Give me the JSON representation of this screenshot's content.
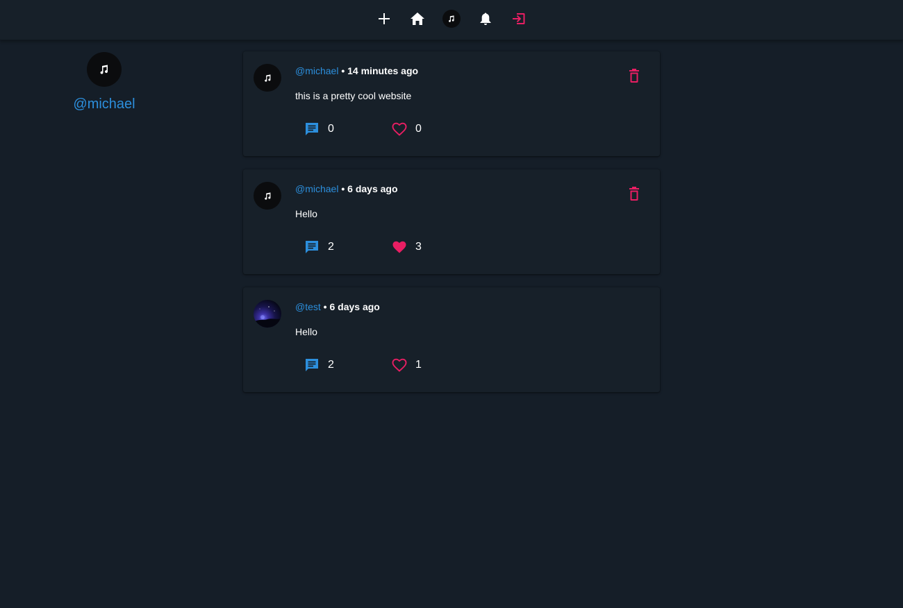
{
  "topbar": {
    "icons": [
      "plus-icon",
      "home-icon",
      "avatar",
      "bell-icon",
      "logout-icon"
    ],
    "accent_logout": "#e91e63"
  },
  "profile": {
    "handle": "@michael",
    "avatar": "music-note-icon"
  },
  "posts": [
    {
      "user": "@michael",
      "separator": "•",
      "time": "14 minutes ago",
      "body": "this is a pretty cool website",
      "comments": "0",
      "likes": "0",
      "liked": false,
      "deletable": true,
      "avatar": "music-note-icon"
    },
    {
      "user": "@michael",
      "separator": "•",
      "time": "6 days ago",
      "body": "Hello",
      "comments": "2",
      "likes": "3",
      "liked": true,
      "deletable": true,
      "avatar": "music-note-icon"
    },
    {
      "user": "@test",
      "separator": "•",
      "time": "6 days ago",
      "body": "Hello",
      "comments": "2",
      "likes": "1",
      "liked": false,
      "deletable": false,
      "avatar": "night-sky-image"
    }
  ],
  "colors": {
    "background": "#151e28",
    "card": "#172029",
    "link_blue": "#2c8fdd",
    "pink": "#e91e63"
  }
}
